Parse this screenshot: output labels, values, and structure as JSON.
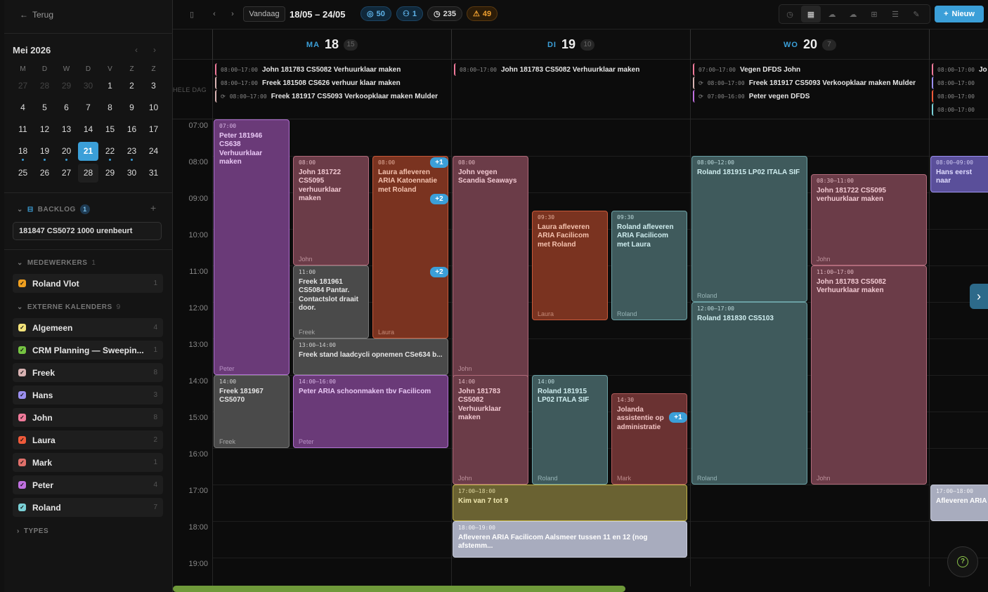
{
  "sidebar": {
    "back_label": "Terug",
    "month_label": "Mei 2026",
    "weekdays": [
      "M",
      "D",
      "W",
      "D",
      "V",
      "Z",
      "Z"
    ],
    "weeks": [
      [
        "27",
        "28",
        "29",
        "30",
        "1",
        "2",
        "3"
      ],
      [
        "4",
        "5",
        "6",
        "7",
        "8",
        "9",
        "10"
      ],
      [
        "11",
        "12",
        "13",
        "14",
        "15",
        "16",
        "17"
      ],
      [
        "18",
        "19",
        "20",
        "21",
        "22",
        "23",
        "24"
      ],
      [
        "25",
        "26",
        "27",
        "28",
        "29",
        "30",
        "31"
      ]
    ],
    "backlog_label": "BACKLOG",
    "backlog_count": "1",
    "backlog_item": "181847 CS5072 1000 urenbeurt",
    "medewerkers_label": "MEDEWERKERS",
    "medewerkers_count": "1",
    "medewerker": {
      "name": "Roland Vlot",
      "count": "1",
      "color": "#f0a020"
    },
    "externe_label": "EXTERNE KALENDERS",
    "externe_count": "9",
    "calendars": [
      {
        "name": "Algemeen",
        "count": "4",
        "color": "#f3e37a"
      },
      {
        "name": "CRM Planning — Sweepin...",
        "count": "1",
        "color": "#76c442"
      },
      {
        "name": "Freek",
        "count": "8",
        "color": "#d9b3b3"
      },
      {
        "name": "Hans",
        "count": "3",
        "color": "#9b8ff0"
      },
      {
        "name": "John",
        "count": "8",
        "color": "#f07a9a"
      },
      {
        "name": "Laura",
        "count": "2",
        "color": "#ef5a3a"
      },
      {
        "name": "Mark",
        "count": "1",
        "color": "#e0706a"
      },
      {
        "name": "Peter",
        "count": "4",
        "color": "#c070e0"
      },
      {
        "name": "Roland",
        "count": "7",
        "color": "#7ad0d6"
      }
    ],
    "types_label": "TYPES"
  },
  "topbar": {
    "today_label": "Vandaag",
    "range_label": "18/05 – 24/05",
    "pill_tasks": "50",
    "pill_people": "1",
    "pill_hours": "235",
    "pill_warnings": "49",
    "new_label": "Nieuw"
  },
  "days": [
    {
      "name": "MA",
      "date": "18",
      "count": "15"
    },
    {
      "name": "DI",
      "date": "19",
      "count": "10"
    },
    {
      "name": "WO",
      "date": "20",
      "count": "7"
    }
  ],
  "allday_label": "HELE DAG",
  "allday": [
    {
      "time": "08:00–17:00",
      "title": "John 181783 CS5082 Verhuurklaar maken"
    },
    {
      "time": "08:00–17:00",
      "title": "Freek 181508 CS626 verhuur klaar maken"
    },
    {
      "time": "08:00–17:00",
      "title": "Freek 181917 CS5093 Verkoopklaar maken Mulder"
    },
    {
      "time": "08:00–17:00",
      "title": "John 181783 CS5082 Verhuurklaar maken"
    },
    {
      "time": "07:00–17:00",
      "title": "Vegen DFDS John"
    },
    {
      "time": "08:00–17:00",
      "title": "Freek 181917 CS5093 Verkoopklaar maken Mulder"
    },
    {
      "time": "07:00–16:00",
      "title": "Peter vegen DFDS"
    },
    {
      "time": "08:00–17:00",
      "title": "Jo"
    },
    {
      "time": "08:00–17:00",
      "title": ""
    },
    {
      "time": "08:00–17:00",
      "title": ""
    },
    {
      "time": "08:00–17:00",
      "title": ""
    }
  ],
  "hours": [
    "07:00",
    "08:00",
    "09:00",
    "10:00",
    "11:00",
    "12:00",
    "13:00",
    "14:00",
    "15:00",
    "16:00",
    "17:00",
    "18:00",
    "19:00"
  ],
  "events": [
    {
      "time": "07:00",
      "title": "Peter 181946 CS638 Verhuurklaar maken",
      "owner": "Peter"
    },
    {
      "time": "08:00",
      "title": "John 181722 CS5095 verhuurklaar maken",
      "owner": "John"
    },
    {
      "time": "08:00",
      "title": "Laura afleveren ARIA Katoennatie met Roland",
      "owner": "Laura"
    },
    {
      "time": "11:00",
      "title": "Freek 181961 CS5084 Pantar. Contactslot draait door.",
      "owner": "Freek"
    },
    {
      "time": "13:00–14:00",
      "title": "Freek stand laadcycli opnemen CSe634 b...",
      "owner": ""
    },
    {
      "time": "14:00",
      "title": "Freek 181967 CS5070",
      "owner": "Freek"
    },
    {
      "time": "14:00–16:00",
      "title": "Peter ARIA schoonmaken tbv Facilicom",
      "owner": "Peter"
    },
    {
      "time": "08:00",
      "title": "John vegen Scandia Seaways",
      "owner": "John"
    },
    {
      "time": "09:30",
      "title": "Laura afleveren ARIA Facilicom met Roland",
      "owner": "Laura"
    },
    {
      "time": "09:30",
      "title": "Roland afleveren ARIA Facilicom met Laura",
      "owner": "Roland"
    },
    {
      "time": "14:00",
      "title": "John 181783 CS5082 Verhuurklaar maken",
      "owner": "John"
    },
    {
      "time": "14:00",
      "title": "Roland 181915 LP02 ITALA SIF",
      "owner": "Roland"
    },
    {
      "time": "14:30",
      "title": "Jolanda assistentie op administratie",
      "owner": "Mark"
    },
    {
      "time": "17:00–18:00",
      "title": "Kim van 7 tot 9",
      "owner": ""
    },
    {
      "time": "18:00–19:00",
      "title": "Afleveren ARIA Facilicom Aalsmeer tussen 11 en 12 (nog afstemm...",
      "owner": ""
    },
    {
      "time": "08:00–12:00",
      "title": "Roland 181915 LP02 ITALA SIF",
      "owner": "Roland"
    },
    {
      "time": "12:00–17:00",
      "title": "Roland 181830 CS5103",
      "owner": "Roland"
    },
    {
      "time": "08:30–11:00",
      "title": "John 181722 CS5095 verhuurklaar maken",
      "owner": "John"
    },
    {
      "time": "11:00–17:00",
      "title": "John 181783 CS5082 Verhuurklaar maken",
      "owner": "John"
    },
    {
      "time": "08:00–09:00",
      "title": "Hans eerst naar",
      "owner": ""
    },
    {
      "time": "17:00–18:00",
      "title": "Afleveren ARIA",
      "owner": ""
    }
  ],
  "plus_badges": [
    "+1",
    "+2",
    "+2",
    "+1"
  ]
}
